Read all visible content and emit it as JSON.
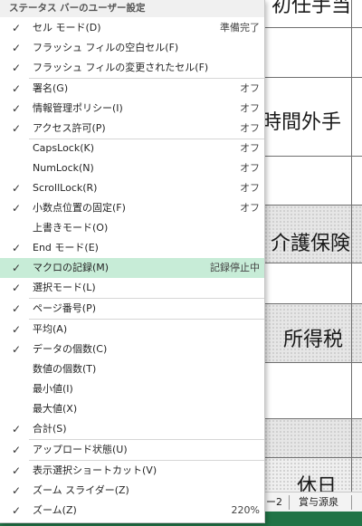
{
  "sheet": {
    "cells": [
      {
        "text": "初任手当"
      },
      {
        "text": "時間外手"
      },
      {
        "text": "介護保険"
      },
      {
        "text": "所得税"
      },
      {
        "text": "休日"
      }
    ],
    "tabs": [
      {
        "label": "ー2"
      },
      {
        "label": "賞与源泉"
      }
    ]
  },
  "menu": {
    "title": "ステータス バーのユーザー設定",
    "check_glyph": "✓",
    "items": [
      {
        "id": "cell-mode",
        "label": "セル モード(D)",
        "value": "準備完了",
        "checked": true
      },
      {
        "id": "flash-fill-blank",
        "label": "フラッシュ フィルの空白セル(F)",
        "value": "",
        "checked": true
      },
      {
        "id": "flash-fill-changed",
        "label": "フラッシュ フィルの変更されたセル(F)",
        "value": "",
        "checked": true
      },
      {
        "id": "signature",
        "label": "署名(G)",
        "value": "オフ",
        "checked": true
      },
      {
        "id": "irm",
        "label": "情報管理ポリシー(I)",
        "value": "オフ",
        "checked": true
      },
      {
        "id": "permission",
        "label": "アクセス許可(P)",
        "value": "オフ",
        "checked": true
      },
      {
        "id": "capslock",
        "label": "CapsLock(K)",
        "value": "オフ",
        "checked": false
      },
      {
        "id": "numlock",
        "label": "NumLock(N)",
        "value": "オフ",
        "checked": false
      },
      {
        "id": "scrolllock",
        "label": "ScrollLock(R)",
        "value": "オフ",
        "checked": true
      },
      {
        "id": "fixed-decimal",
        "label": "小数点位置の固定(F)",
        "value": "オフ",
        "checked": true
      },
      {
        "id": "overtype",
        "label": "上書きモード(O)",
        "value": "",
        "checked": false
      },
      {
        "id": "end-mode",
        "label": "End モード(E)",
        "value": "",
        "checked": true
      },
      {
        "id": "macro-recording",
        "label": "マクロの記録(M)",
        "value": "記録停止中",
        "checked": true,
        "highlighted": true
      },
      {
        "id": "selection-mode",
        "label": "選択モード(L)",
        "value": "",
        "checked": true
      },
      {
        "id": "page-number",
        "label": "ページ番号(P)",
        "value": "",
        "checked": true
      },
      {
        "id": "average",
        "label": "平均(A)",
        "value": "",
        "checked": true
      },
      {
        "id": "count",
        "label": "データの個数(C)",
        "value": "",
        "checked": true
      },
      {
        "id": "numerical-count",
        "label": "数値の個数(T)",
        "value": "",
        "checked": false
      },
      {
        "id": "minimum",
        "label": "最小値(I)",
        "value": "",
        "checked": false
      },
      {
        "id": "maximum",
        "label": "最大値(X)",
        "value": "",
        "checked": false
      },
      {
        "id": "sum",
        "label": "合計(S)",
        "value": "",
        "checked": true
      },
      {
        "id": "upload-status",
        "label": "アップロード状態(U)",
        "value": "",
        "checked": true
      },
      {
        "id": "view-shortcuts",
        "label": "表示選択ショートカット(V)",
        "value": "",
        "checked": true
      },
      {
        "id": "zoom-slider",
        "label": "ズーム スライダー(Z)",
        "value": "",
        "checked": true
      },
      {
        "id": "zoom",
        "label": "ズーム(Z)",
        "value": "220%",
        "checked": true
      }
    ]
  },
  "colors": {
    "highlight": "#c7ecd7",
    "status_bar": "#217346",
    "menu_title_bg": "#f0f0f0"
  }
}
